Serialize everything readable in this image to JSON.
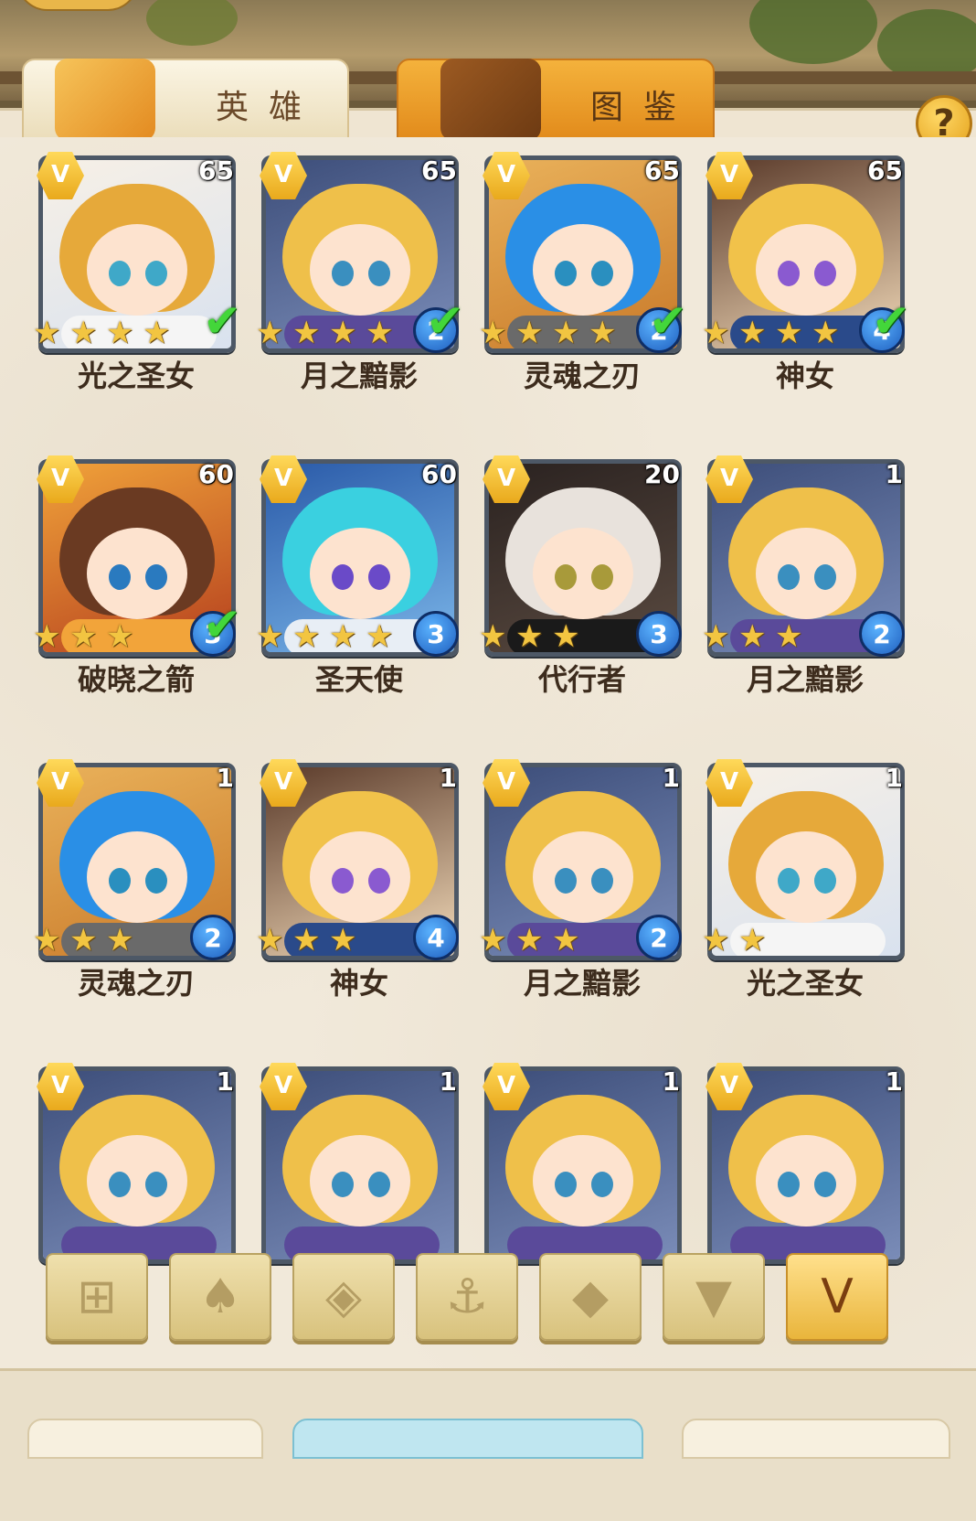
{
  "tabs": {
    "heroes_label": "英雄",
    "codex_label": "图鉴",
    "help_label": "?"
  },
  "colors": {
    "tab_active": "#f1e3be",
    "tab_codex": "#e8961f",
    "panel": "#f1e9da",
    "name_text": "#3d2c1d",
    "check": "#43d63a",
    "gem": "#1f5fbf",
    "rank_badge": "#e9a91c"
  },
  "heroes": [
    {
      "name": "光之圣女",
      "level": "65",
      "stars": 4,
      "grade": "",
      "selected": true,
      "theme": "lightsaint"
    },
    {
      "name": "月之黯影",
      "level": "65",
      "stars": 4,
      "grade": "2",
      "selected": true,
      "theme": "moon"
    },
    {
      "name": "灵魂之刃",
      "level": "65",
      "stars": 4,
      "grade": "2",
      "selected": true,
      "theme": "soul"
    },
    {
      "name": "神女",
      "level": "65",
      "stars": 4,
      "grade": "4",
      "selected": true,
      "theme": "goddess"
    },
    {
      "name": "破晓之箭",
      "level": "60",
      "stars": 3,
      "grade": "3",
      "selected": true,
      "theme": "dawn"
    },
    {
      "name": "圣天使",
      "level": "60",
      "stars": 4,
      "grade": "3",
      "selected": false,
      "theme": "angel"
    },
    {
      "name": "代行者",
      "level": "20",
      "stars": 3,
      "grade": "3",
      "selected": false,
      "theme": "agent"
    },
    {
      "name": "月之黯影",
      "level": "1",
      "stars": 3,
      "grade": "2",
      "selected": false,
      "theme": "moon"
    },
    {
      "name": "灵魂之刃",
      "level": "1",
      "stars": 3,
      "grade": "2",
      "selected": false,
      "theme": "soul"
    },
    {
      "name": "神女",
      "level": "1",
      "stars": 3,
      "grade": "4",
      "selected": false,
      "theme": "goddess"
    },
    {
      "name": "月之黯影",
      "level": "1",
      "stars": 3,
      "grade": "2",
      "selected": false,
      "theme": "moon"
    },
    {
      "name": "光之圣女",
      "level": "1",
      "stars": 2,
      "grade": "",
      "selected": false,
      "theme": "lightsaint"
    },
    {
      "name": "",
      "level": "1",
      "stars": 0,
      "grade": "",
      "selected": false,
      "theme": "moon"
    },
    {
      "name": "",
      "level": "1",
      "stars": 0,
      "grade": "",
      "selected": false,
      "theme": "moon"
    },
    {
      "name": "",
      "level": "1",
      "stars": 0,
      "grade": "",
      "selected": false,
      "theme": "moon"
    },
    {
      "name": "",
      "level": "1",
      "stars": 0,
      "grade": "",
      "selected": false,
      "theme": "moon"
    }
  ],
  "filters": [
    {
      "icon": "grid-icon",
      "glyph": "⊞",
      "active": false
    },
    {
      "icon": "flame-icon",
      "glyph": "♠",
      "active": false
    },
    {
      "icon": "diamond-icon",
      "glyph": "◈",
      "active": false
    },
    {
      "icon": "anchor-icon",
      "glyph": "⚓",
      "active": false
    },
    {
      "icon": "beast-icon",
      "glyph": "◆",
      "active": false
    },
    {
      "icon": "fox-icon",
      "glyph": "▼",
      "active": false
    },
    {
      "icon": "rank-v-icon",
      "glyph": "V",
      "active": true
    }
  ]
}
